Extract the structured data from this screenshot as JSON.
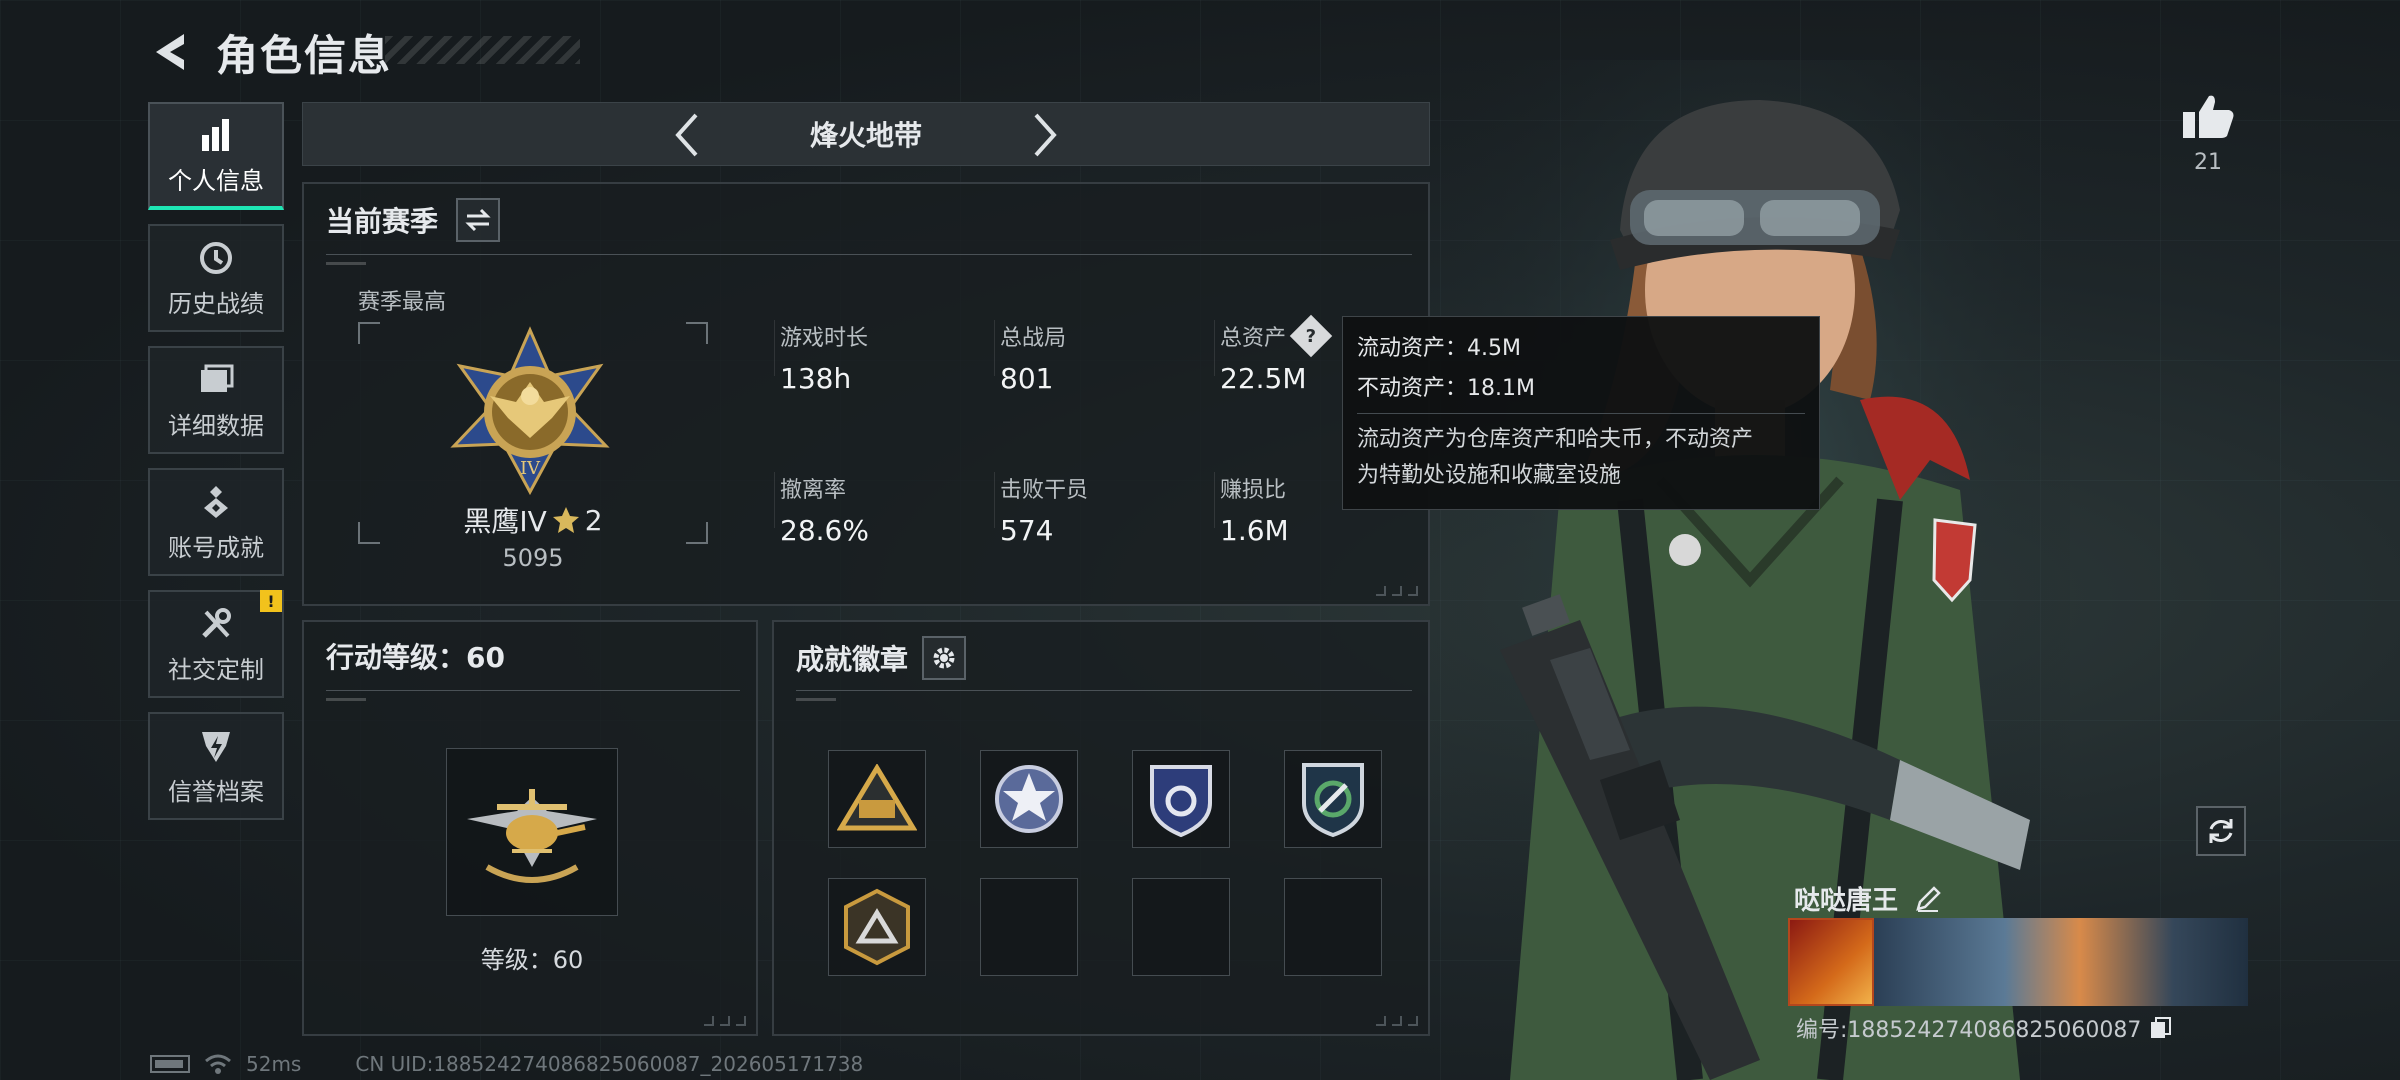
{
  "header": {
    "title": "角色信息"
  },
  "nav": {
    "items": [
      {
        "label": "个人信息",
        "active": true
      },
      {
        "label": "历史战绩"
      },
      {
        "label": "详细数据"
      },
      {
        "label": "账号成就"
      },
      {
        "label": "社交定制",
        "badge": "!"
      },
      {
        "label": "信誉档案"
      }
    ]
  },
  "mode": {
    "title": "烽火地带"
  },
  "season": {
    "title": "当前赛季",
    "best_label": "赛季最高",
    "rank_name": "黑鹰IV",
    "rank_stars": "2",
    "rank_score": "5095",
    "stats": [
      {
        "label": "游戏时长",
        "value": "138h"
      },
      {
        "label": "总战局",
        "value": "801"
      },
      {
        "label": "总资产",
        "value": "22.5M"
      },
      {
        "label": "撤离率",
        "value": "28.6%"
      },
      {
        "label": "击败干员",
        "value": "574"
      },
      {
        "label": "赚损比",
        "value": "1.6M"
      }
    ]
  },
  "tooltip": {
    "liquid": "流动资产：4.5M",
    "fixed": "不动资产：18.1M",
    "desc_line1": "流动资产为仓库资产和哈夫币，不动资产",
    "desc_line2": "为特勤处设施和收藏室设施"
  },
  "level": {
    "title": "行动等级：60",
    "text": "等级：60"
  },
  "badges": {
    "title": "成就徽章"
  },
  "status": {
    "ping": "52ms",
    "uid": "CN UID:188524274086825060087_202605171738"
  },
  "profile": {
    "likes": "21",
    "name": "哒哒唐王",
    "id": "编号:188524274086825060087"
  },
  "colors": {
    "accent": "#1ee6b4",
    "alert": "#f2c21c",
    "tooltip_bg": "#0f1112"
  }
}
